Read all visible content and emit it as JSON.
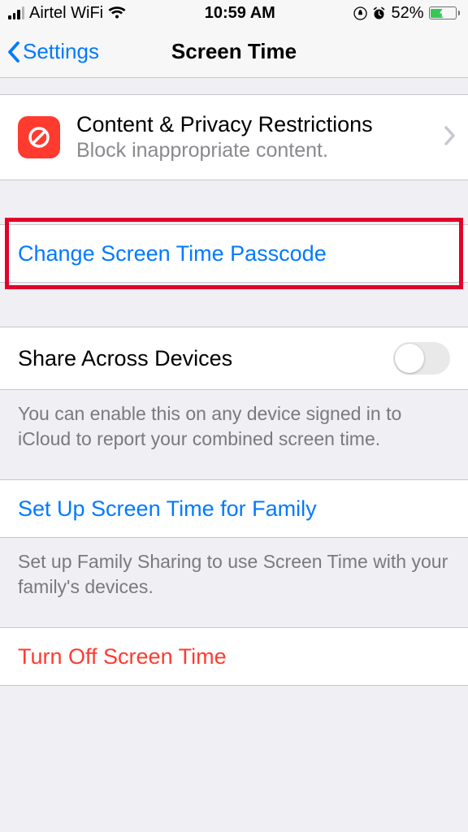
{
  "status": {
    "carrier": "Airtel WiFi",
    "time": "10:59 AM",
    "battery_pct": "52%",
    "battery_fill_pct": 52
  },
  "nav": {
    "back_label": "Settings",
    "title": "Screen Time"
  },
  "content_privacy": {
    "title": "Content & Privacy Restrictions",
    "subtitle": "Block inappropriate content."
  },
  "change_passcode": {
    "label": "Change Screen Time Passcode"
  },
  "share_devices": {
    "label": "Share Across Devices",
    "footer": "You can enable this on any device signed in to iCloud to report your combined screen time."
  },
  "family": {
    "label": "Set Up Screen Time for Family",
    "footer": "Set up Family Sharing to use Screen Time with your family's devices."
  },
  "turn_off": {
    "label": "Turn Off Screen Time"
  }
}
